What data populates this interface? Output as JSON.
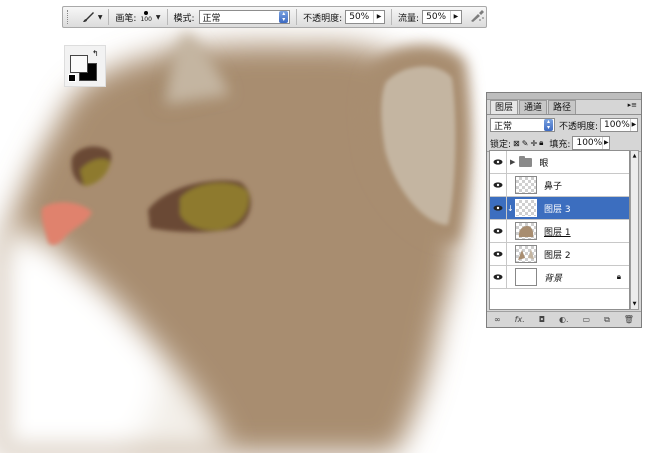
{
  "options_bar": {
    "tool_icon": "brush-icon",
    "brush_label": "画笔:",
    "brush_size": "100",
    "mode_label": "模式:",
    "mode_value": "正常",
    "opacity_label": "不透明度:",
    "opacity_value": "50%",
    "flow_label": "流量:",
    "flow_value": "50%",
    "airbrush_icon": "airbrush-icon"
  },
  "colors": {
    "foreground": "#fafafa",
    "background": "#000000",
    "cat_fur": "#a88d70",
    "ear_inner": "#c4b5a1",
    "eye_iris": "#8e7a2d",
    "eye_socket": "#6b4a35",
    "nose": "#e0826d",
    "selection": "#3c6ebf"
  },
  "layers_panel": {
    "tabs": [
      {
        "label": "图层",
        "active": true
      },
      {
        "label": "通道",
        "active": false
      },
      {
        "label": "路径",
        "active": false
      }
    ],
    "blend_mode": "正常",
    "opacity_label": "不透明度:",
    "opacity_value": "100%",
    "lock_label": "锁定:",
    "fill_label": "填充:",
    "fill_value": "100%",
    "layers": [
      {
        "name": "眼",
        "type": "group",
        "visible": true,
        "selected": false
      },
      {
        "name": "鼻子",
        "type": "transparent",
        "visible": true,
        "selected": false
      },
      {
        "name": "图层 3",
        "type": "transparent",
        "visible": true,
        "selected": true
      },
      {
        "name": "图层 1",
        "type": "cat",
        "visible": true,
        "selected": false
      },
      {
        "name": "图层 2",
        "type": "ears",
        "visible": true,
        "selected": false
      },
      {
        "name": "背景",
        "type": "background",
        "visible": true,
        "selected": false,
        "locked": true
      }
    ],
    "bottom_icons": [
      "link-layers-icon",
      "fx-icon",
      "mask-icon",
      "adjustment-icon",
      "group-icon",
      "new-layer-icon",
      "trash-icon"
    ]
  }
}
